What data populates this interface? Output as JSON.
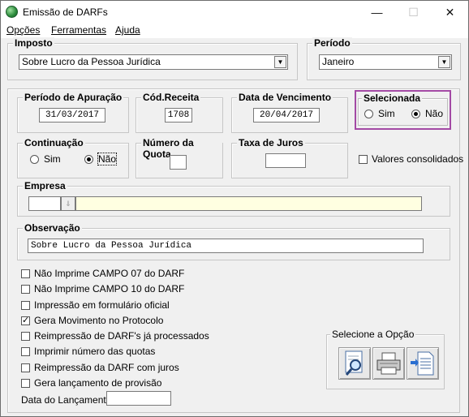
{
  "window": {
    "title": "Emissão de DARFs",
    "minimize": "—",
    "maximize": "☐",
    "close": "✕"
  },
  "menu": [
    "Opções",
    "Ferramentas",
    "Ajuda"
  ],
  "imposto": {
    "label": "Imposto",
    "value": "Sobre Lucro da Pessoa Jurídica"
  },
  "periodo": {
    "label": "Período",
    "value": "Janeiro"
  },
  "apuracao": {
    "label": "Período de Apuração",
    "value": "31/03/2017"
  },
  "receita": {
    "label": "Cód.Receita",
    "value": "1708"
  },
  "vencimento": {
    "label": "Data de Vencimento",
    "value": "20/04/2017"
  },
  "selecionada": {
    "label": "Selecionada",
    "opt_sim": "Sim",
    "opt_nao": "Não",
    "selected": "Não"
  },
  "continuacao": {
    "label": "Continuação",
    "opt_sim": "Sim",
    "opt_nao": "Não",
    "selected": "Não"
  },
  "quota": {
    "label": "Número da Quota",
    "value": ""
  },
  "juros": {
    "label": "Taxa de Juros",
    "value": ""
  },
  "valores_consolidados": {
    "label": "Valores consolidados",
    "checked": false
  },
  "empresa": {
    "label": "Empresa",
    "code": "",
    "name": ""
  },
  "observacao": {
    "label": "Observação",
    "value": "Sobre Lucro da Pessoa Jurídica"
  },
  "options": [
    {
      "label": "Não Imprime CAMPO 07 do DARF",
      "checked": false
    },
    {
      "label": "Não Imprime CAMPO 10 do DARF",
      "checked": false
    },
    {
      "label": "Impressão em formulário oficial",
      "checked": false
    },
    {
      "label": "Gera Movimento no Protocolo",
      "checked": true
    },
    {
      "label": "Reimpressão de DARF's já processados",
      "checked": false
    },
    {
      "label": "Imprimir número das quotas",
      "checked": false
    },
    {
      "label": "Reimpressão da DARF com juros",
      "checked": false
    },
    {
      "label": "Gera lançamento de provisão",
      "checked": false
    }
  ],
  "data_lancamento": {
    "label": "Data do Lançamento:",
    "value": ""
  },
  "selecione": {
    "label": "Selecione a Opção"
  },
  "icons": {
    "preview": "magnifier-doc-icon",
    "print": "printer-icon",
    "export": "export-doc-icon"
  },
  "colors": {
    "highlight": "#a349a4",
    "empresa_field": "#ffffe1"
  }
}
